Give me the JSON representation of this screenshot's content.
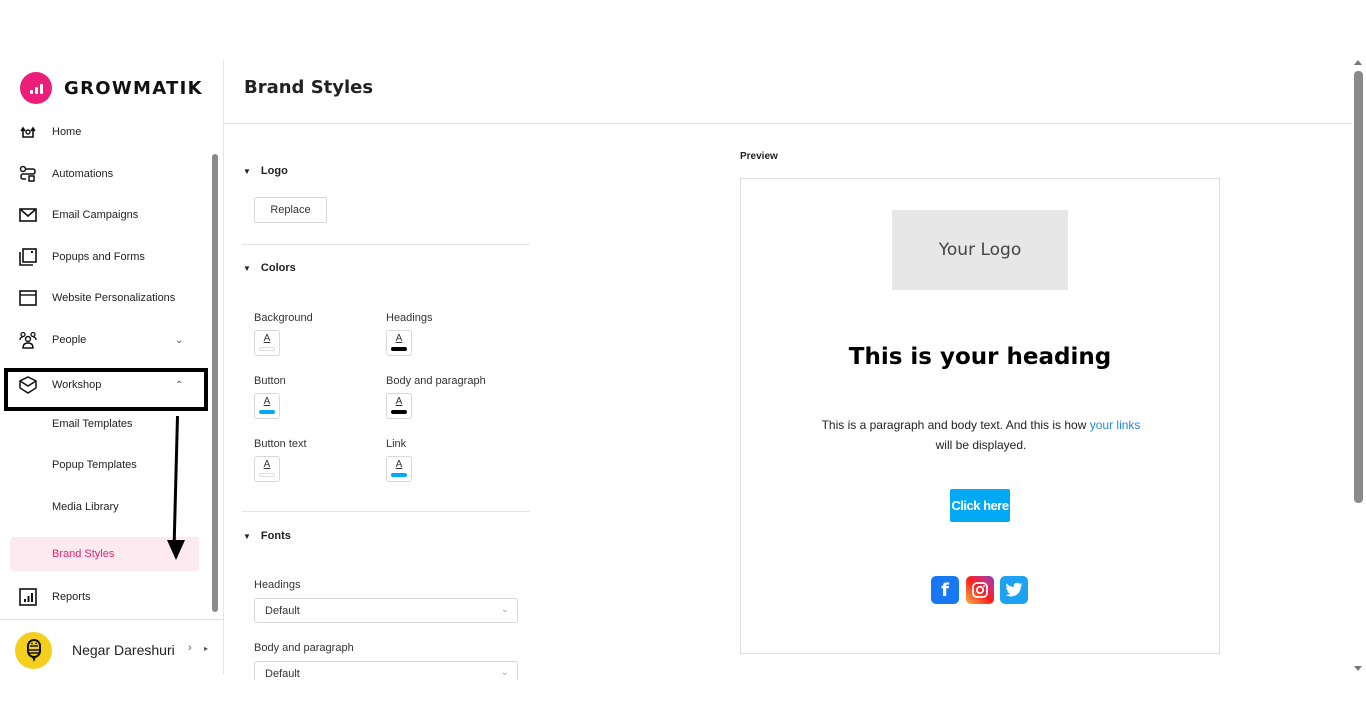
{
  "app": {
    "brand": "GROWMATIK",
    "brand_color": "#ec1e79"
  },
  "sidebar": {
    "items": [
      {
        "label": "Home",
        "icon": "home-icon"
      },
      {
        "label": "Automations",
        "icon": "automations-icon"
      },
      {
        "label": "Email Campaigns",
        "icon": "mail-icon"
      },
      {
        "label": "Popups and Forms",
        "icon": "popup-icon"
      },
      {
        "label": "Website Personalizations",
        "icon": "browser-window-icon"
      },
      {
        "label": "People",
        "icon": "people-icon",
        "chevron": "⌄"
      },
      {
        "label": "Workshop",
        "icon": "box-icon",
        "chevron": "⌃"
      }
    ],
    "sub_items": [
      {
        "label": "Email Templates"
      },
      {
        "label": "Popup Templates"
      },
      {
        "label": "Media Library"
      },
      {
        "label": "Brand Styles",
        "active": true
      }
    ],
    "reports": {
      "label": "Reports",
      "icon": "reports-icon"
    },
    "user": {
      "name": "Negar Dareshuri",
      "chevron": "›",
      "chevron_small": "▸"
    }
  },
  "page": {
    "title": "Brand Styles"
  },
  "logo_section": {
    "title": "Logo",
    "replace_label": "Replace"
  },
  "colors_section": {
    "title": "Colors",
    "fields": [
      {
        "label": "Background",
        "color": "#ffffff"
      },
      {
        "label": "Headings",
        "color": "#000000"
      },
      {
        "label": "Button",
        "color": "#03a9f4"
      },
      {
        "label": "Body and paragraph",
        "color": "#000000"
      },
      {
        "label": "Button text",
        "color": "#ffffff"
      },
      {
        "label": "Link",
        "color": "#03a9f4"
      }
    ],
    "swatch_glyph": "A"
  },
  "fonts_section": {
    "title": "Fonts",
    "headings_label": "Headings",
    "headings_value": "Default",
    "body_label": "Body and paragraph",
    "body_value": "Default"
  },
  "preview": {
    "label": "Preview",
    "logo_placeholder": "Your Logo",
    "heading": "This is your heading",
    "para_before": "This is a paragraph and body text. And this is how ",
    "para_link": "your links",
    "para_after": " will be displayed.",
    "button_label": "Click here",
    "social": [
      "facebook",
      "instagram",
      "twitter"
    ]
  },
  "glyphs": {
    "section_open": "▼",
    "select_chevron": "⌄"
  }
}
